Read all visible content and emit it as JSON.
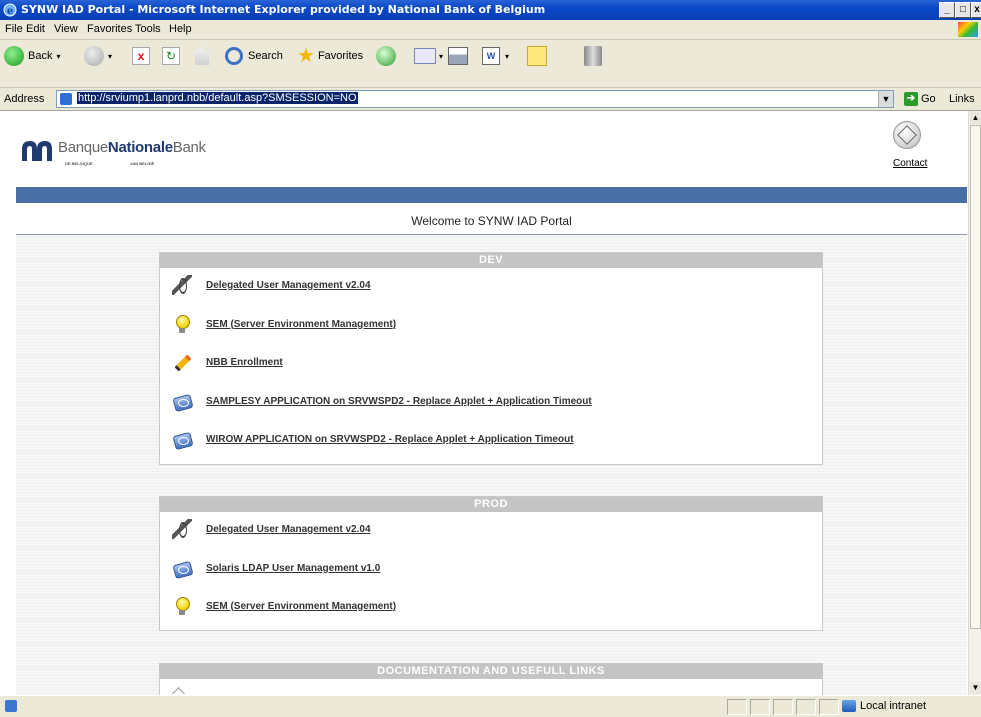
{
  "window": {
    "title": "SYNW IAD Portal - Microsoft Internet Explorer provided by National Bank of Belgium",
    "controls": {
      "minimize": "_",
      "maximize": "□",
      "close": "x"
    }
  },
  "menu": {
    "items": [
      "File",
      "Edit",
      "View",
      "Favorites",
      "Tools",
      "Help"
    ]
  },
  "toolbar": {
    "back_label": "Back",
    "search_label": "Search",
    "favorites_label": "Favorites"
  },
  "address_bar": {
    "label": "Address",
    "url": "http://srviump1.lanprd.nbb/default.asp?SMSESSION=NO",
    "go_label": "Go",
    "links_label": "Links"
  },
  "page": {
    "logo": {
      "prefix": "Banque",
      "bold": "Nationale",
      "suffix": "Bank",
      "sub_left": "DE BELGIQUE",
      "sub_right": "VAN BELGIË"
    },
    "contact_label": "Contact",
    "welcome": "Welcome to SYNW IAD Portal",
    "sections": [
      {
        "title": "DEV",
        "items": [
          {
            "icon": "pen-icon",
            "label": "Delegated User Management v2.04"
          },
          {
            "icon": "lightbulb-icon",
            "label": "SEM (Server Environment Management)"
          },
          {
            "icon": "pencil-icon",
            "label": "NBB Enrollment"
          },
          {
            "icon": "disk-icon",
            "label": "SAMPLESY APPLICATION on SRVWSPD2 - Replace Applet + Application Timeout"
          },
          {
            "icon": "disk-icon",
            "label": "WIROW APPLICATION on SRVWSPD2 - Replace Applet + Application Timeout"
          }
        ]
      },
      {
        "title": "PROD",
        "items": [
          {
            "icon": "pen-icon",
            "label": "Delegated User Management v2.04"
          },
          {
            "icon": "disk-icon",
            "label": "Solaris LDAP User Management v1.0"
          },
          {
            "icon": "lightbulb-icon",
            "label": "SEM (Server Environment Management)"
          }
        ]
      },
      {
        "title": "DOCUMENTATION AND USEFULL LINKS",
        "items": []
      }
    ]
  },
  "status_bar": {
    "zone": "Local intranet"
  }
}
